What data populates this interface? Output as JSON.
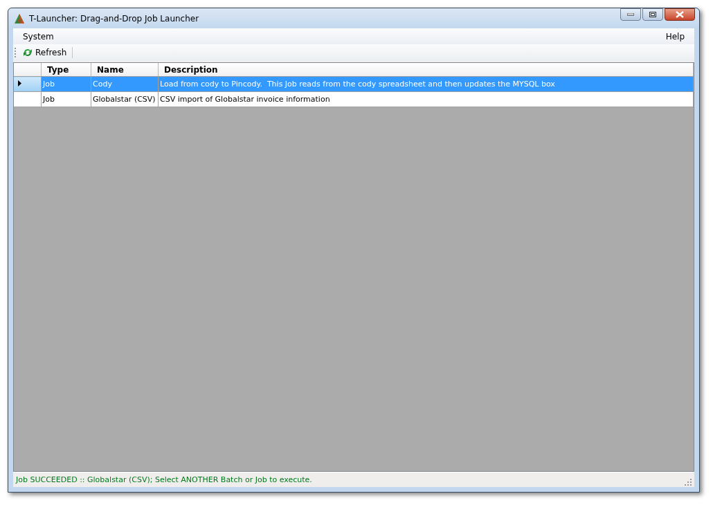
{
  "window": {
    "title": "T-Launcher: Drag-and-Drop Job Launcher"
  },
  "menu": {
    "left": [
      {
        "label": "System"
      }
    ],
    "right": [
      {
        "label": "Help"
      }
    ]
  },
  "toolbar": [
    {
      "label": "Refresh"
    }
  ],
  "table": {
    "columns": [
      "Type",
      "Name",
      "Description"
    ],
    "rows": [
      {
        "selected": true,
        "cells": [
          "Job",
          "Cody",
          "Load from cody to Pincody.  This Job reads from the cody spreadsheet and then updates the MYSQL box"
        ]
      },
      {
        "selected": false,
        "cells": [
          "Job",
          "Globalstar (CSV)",
          "CSV import of Globalstar invoice information"
        ]
      }
    ]
  },
  "status_bar": {
    "text": "Job SUCCEEDED :: Globalstar (CSV); Select ANOTHER Batch or Job to execute."
  }
}
